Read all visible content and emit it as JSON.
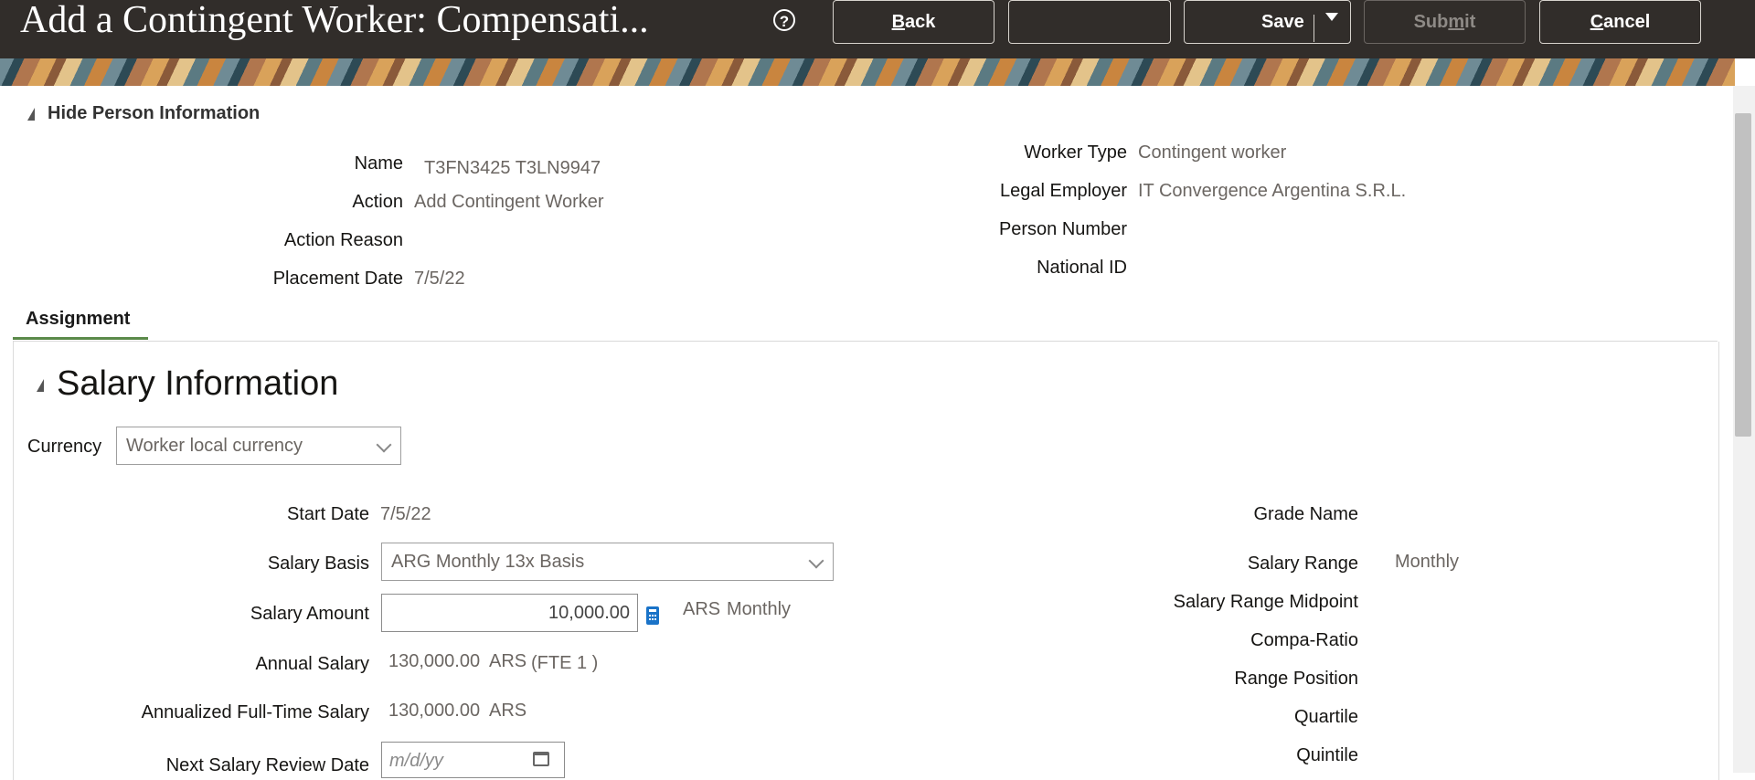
{
  "header": {
    "title": "Add a Contingent Worker: Compensati...",
    "buttons": {
      "back": "Back",
      "blank": "",
      "save": "Save",
      "submit": "Submit",
      "cancel": "Cancel"
    }
  },
  "person_info": {
    "toggle_label": "Hide Person Information",
    "left": [
      {
        "label": "Name",
        "value": "T3FN3425 T3LN9947"
      },
      {
        "label": "Action",
        "value": "Add Contingent Worker"
      },
      {
        "label": "Action Reason",
        "value": ""
      },
      {
        "label": "Placement Date",
        "value": "7/5/22"
      }
    ],
    "right": [
      {
        "label": "Worker Type",
        "value": "Contingent worker"
      },
      {
        "label": "Legal Employer",
        "value": "IT Convergence Argentina S.R.L."
      },
      {
        "label": "Person Number",
        "value": ""
      },
      {
        "label": "National ID",
        "value": ""
      }
    ]
  },
  "tabs": [
    {
      "label": "Assignment",
      "selected": true
    }
  ],
  "salary": {
    "section_title": "Salary Information",
    "currency_label": "Currency",
    "currency_value": "Worker local currency",
    "start_date_label": "Start Date",
    "start_date_value": "7/5/22",
    "salary_basis_label": "Salary Basis",
    "salary_basis_value": "ARG Monthly 13x Basis",
    "salary_amount_label": "Salary Amount",
    "salary_amount_value": "10,000.00",
    "salary_amount_currency": "ARS",
    "salary_amount_frequency": "Monthly",
    "annual_salary_label": "Annual Salary",
    "annual_salary_value": "130,000.00",
    "annual_salary_currency": "ARS",
    "annual_salary_fte": "(FTE 1 )",
    "annualized_label": "Annualized Full-Time Salary",
    "annualized_value": "130,000.00",
    "annualized_currency": "ARS",
    "next_review_label": "Next Salary Review Date",
    "next_review_placeholder": "m/d/yy",
    "grade_name_label": "Grade Name",
    "salary_range_label": "Salary Range",
    "salary_range_value": "Monthly",
    "midpoint_label": "Salary Range Midpoint",
    "compa_ratio_label": "Compa-Ratio",
    "range_position_label": "Range Position",
    "quartile_label": "Quartile",
    "quintile_label": "Quintile"
  },
  "colors": {
    "header_bg": "#312d2a",
    "tab_underline": "#5b8a4a",
    "calculator_icon": "#1a73c8"
  }
}
